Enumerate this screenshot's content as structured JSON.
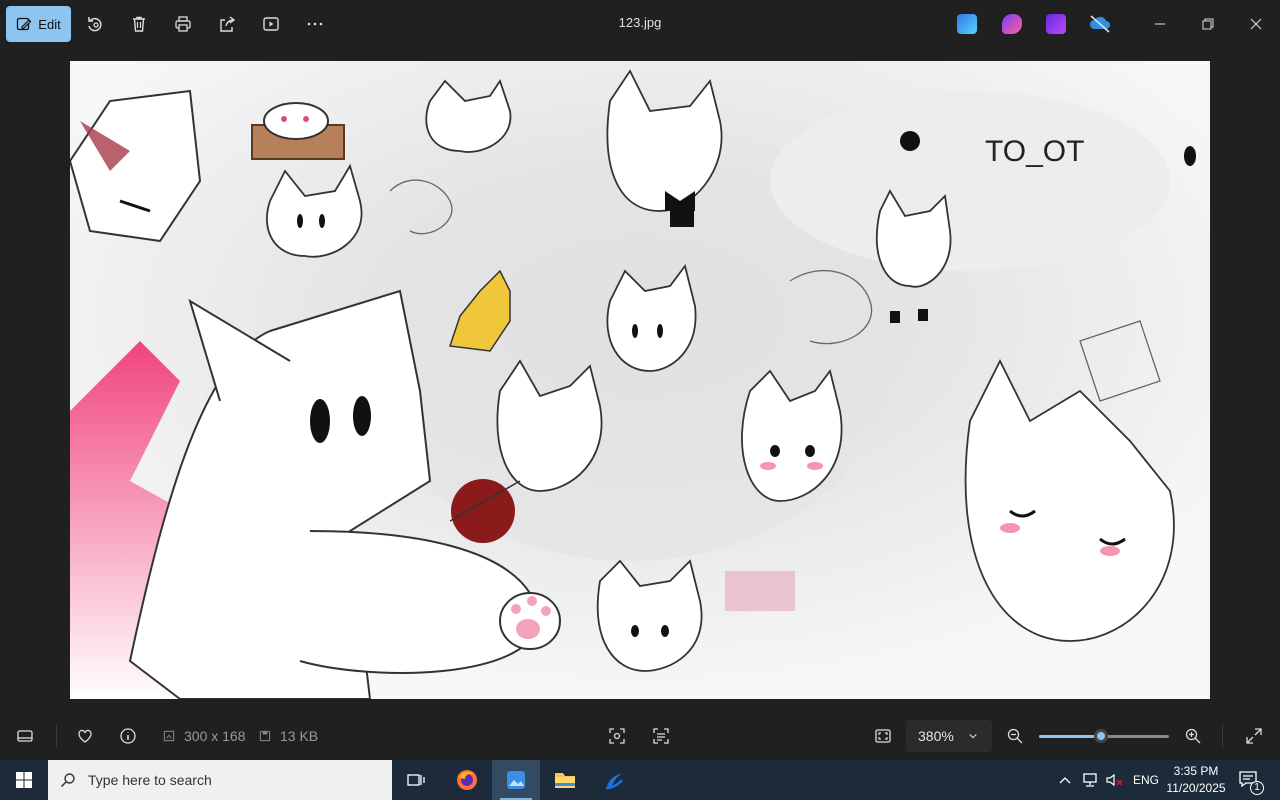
{
  "toolbar": {
    "edit_label": "Edit",
    "title": "123.jpg"
  },
  "icons": {
    "edit": "edit-image-icon",
    "rotate": "rotate-icon",
    "delete": "trash-icon",
    "print": "print-icon",
    "share": "share-icon",
    "slideshow": "slideshow-icon",
    "more": "more-icon"
  },
  "image": {
    "description_text": "TO_OT"
  },
  "status": {
    "dimensions": "300 x 168",
    "file_size": "13 KB",
    "zoom": "380%",
    "zoom_slider_fraction": 0.48
  },
  "taskbar": {
    "search_placeholder": "Type here to search",
    "language": "ENG",
    "time": "3:35 PM",
    "date": "11/20/2025",
    "notification_count": "1"
  },
  "colors": {
    "accent": "#8dc4f0",
    "toolbar_bg": "#202020",
    "taskbar_bg": "#1c2a3a"
  }
}
